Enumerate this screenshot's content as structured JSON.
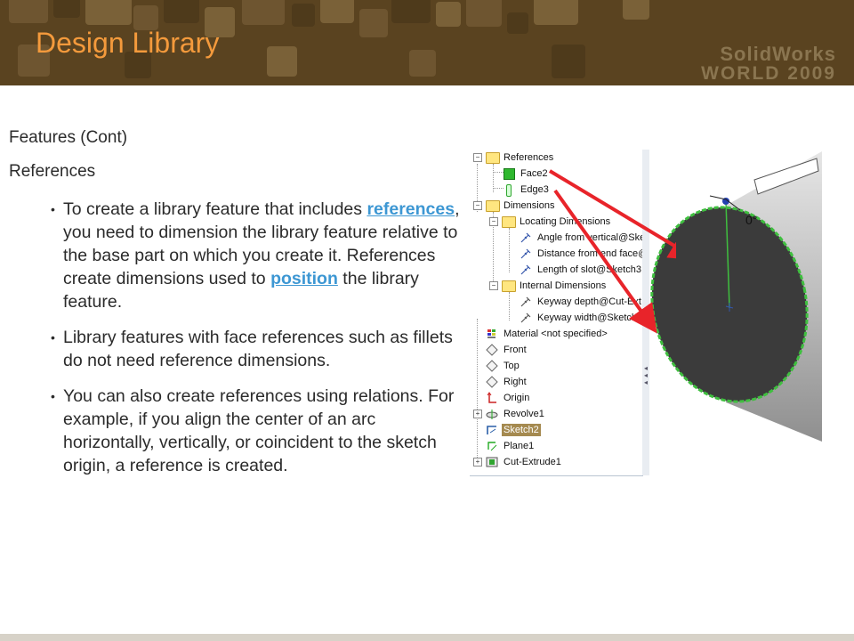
{
  "slide": {
    "title": "Design Library",
    "logo": {
      "line1": "SolidWorks",
      "line2": "WORLD 2009"
    },
    "subtitle": "Features (Cont)",
    "section": "References",
    "bullets": [
      {
        "before": "To create a library feature that includes ",
        "link": "references",
        "after": ", you need to dimension the library feature relative to the base part on which you create it. References create dimensions used to ",
        "link2": "position",
        "after2": " the library feature."
      },
      {
        "text": "Library features with face references such as fillets do not need reference dimensions."
      },
      {
        "text": "You can also create references using relations. For example, if you align the center of an arc horizontally, vertically, or coincident to the sketch origin, a reference is created."
      }
    ]
  },
  "feature_tree": {
    "items": [
      {
        "label": "References",
        "icon": "folder-icon",
        "expander": "−"
      },
      {
        "label": "Face2",
        "icon": "face-icon"
      },
      {
        "label": "Edge3",
        "icon": "edge-icon"
      },
      {
        "label": "Dimensions",
        "icon": "folder-icon",
        "expander": "−"
      },
      {
        "label": "Locating Dimensions",
        "icon": "folder-icon",
        "expander": "−"
      },
      {
        "label": "Angle from vertical@Ske",
        "icon": "dimension-icon"
      },
      {
        "label": "Distance from end face@",
        "icon": "dimension-icon"
      },
      {
        "label": "Length of slot@Sketch3",
        "icon": "dimension-icon"
      },
      {
        "label": "Internal Dimensions",
        "icon": "folder-icon",
        "expander": "−"
      },
      {
        "label": "Keyway depth@Cut-Ext",
        "icon": "dimension-icon"
      },
      {
        "label": "Keyway width@Sketch3",
        "icon": "dimension-icon"
      },
      {
        "label": "Material <not specified>",
        "icon": "material-icon"
      },
      {
        "label": "Front",
        "icon": "plane-icon"
      },
      {
        "label": "Top",
        "icon": "plane-icon"
      },
      {
        "label": "Right",
        "icon": "plane-icon"
      },
      {
        "label": "Origin",
        "icon": "origin-icon"
      },
      {
        "label": "Revolve1",
        "icon": "revolve-icon",
        "expander": "+"
      },
      {
        "label": "Sketch2",
        "icon": "sketch-icon"
      },
      {
        "label": "Plane1",
        "icon": "plane-icon"
      },
      {
        "label": "Cut-Extrude1",
        "icon": "cut-extrude-icon",
        "expander": "+"
      }
    ]
  },
  "viewport": {
    "angle_label": "0°"
  },
  "colors": {
    "title": "#f49a3c",
    "link": "#3d97d3",
    "header": "#5a4320",
    "arrow": "#e8242a",
    "edge_highlight": "#3fbf3f"
  }
}
